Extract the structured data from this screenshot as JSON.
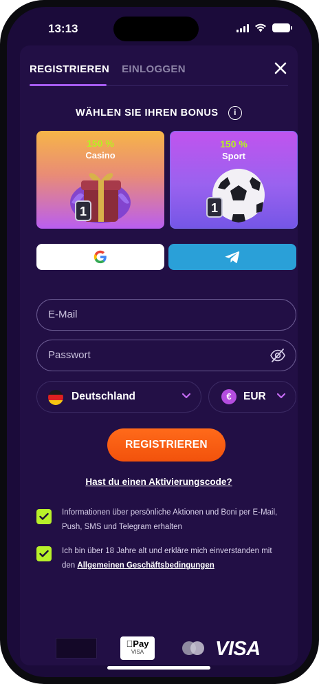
{
  "status_bar": {
    "time": "13:13"
  },
  "tabs": [
    {
      "label": "REGISTRIEREN",
      "active": true
    },
    {
      "label": "EINLOGGEN",
      "active": false
    }
  ],
  "bonus": {
    "title": "WÄHLEN SIE IHREN BONUS",
    "info_icon": "i",
    "cards": [
      {
        "percent": "150 %",
        "name": "Casino",
        "icon": "gift-box-icon"
      },
      {
        "percent": "150 %",
        "name": "Sport",
        "icon": "soccer-ball-icon"
      }
    ]
  },
  "social_buttons": [
    {
      "name": "google",
      "icon": "google-icon"
    },
    {
      "name": "telegram",
      "icon": "telegram-icon"
    }
  ],
  "form": {
    "email_placeholder": "E-Mail",
    "email_value": "",
    "password_placeholder": "Passwort",
    "password_value": "",
    "country": "Deutschland",
    "currency": "EUR",
    "currency_symbol": "€",
    "submit_label": "REGISTRIEREN"
  },
  "activation_link": "Hast du einen Aktivierungscode?",
  "consents": [
    {
      "checked": true,
      "text": "Informationen über persönliche Aktionen und Boni per E-Mail, Push, SMS und Telegram erhalten"
    },
    {
      "checked": true,
      "text_prefix": "Ich bin über 18 Jahre alt und erkläre mich einverstanden mit den",
      "link": "Allgemeinen Geschäftsbedingungen"
    }
  ],
  "footer": {
    "payments": [
      "Pay",
      "VISA"
    ],
    "applepay_sub": "VISA",
    "visa_label": "VISA"
  },
  "colors": {
    "background": "#1b0b3a",
    "accent_tab": "#a55bf0",
    "submit": "#ff6a1a",
    "checkbox": "#b8f02a",
    "bonus_percent": "#b6f022",
    "telegram": "#2aa0d8"
  }
}
